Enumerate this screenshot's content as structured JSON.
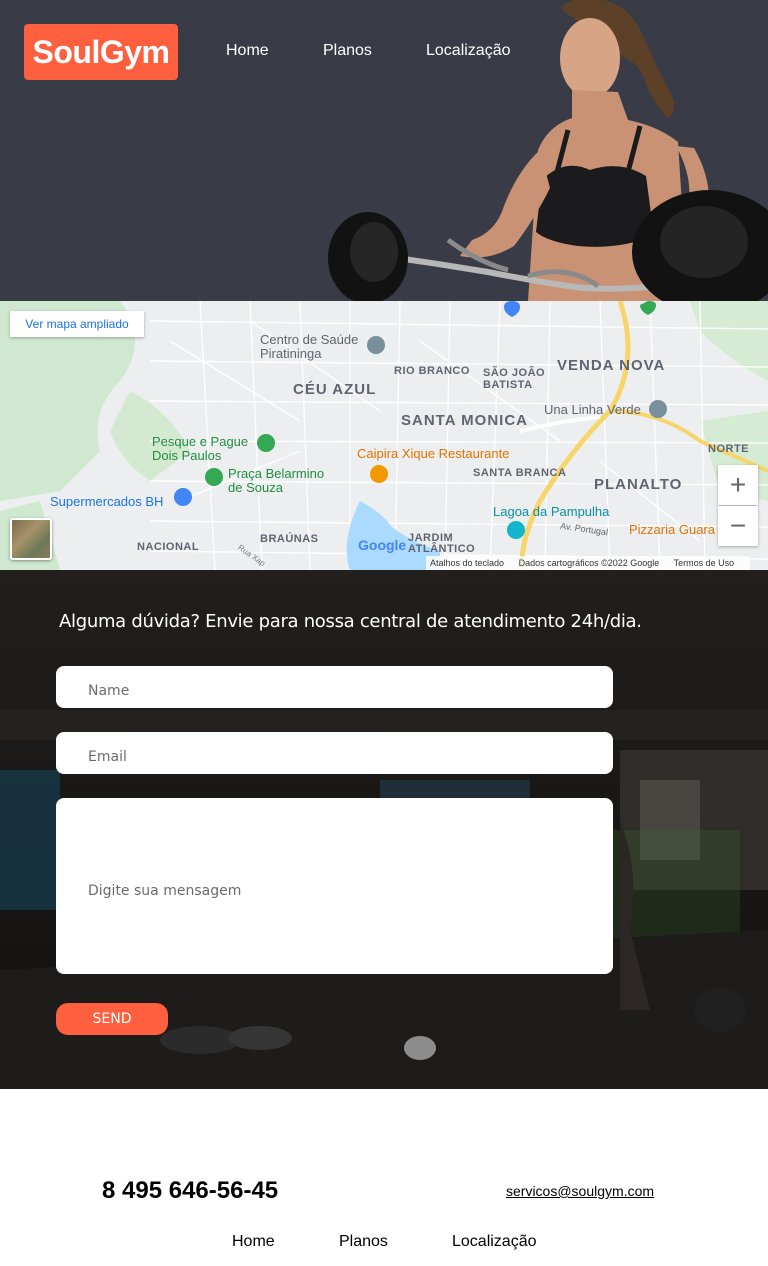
{
  "header": {
    "logo": "SoulGym",
    "nav": [
      "Home",
      "Planos",
      "Localização"
    ]
  },
  "map": {
    "expand_label": "Ver mapa ampliado",
    "zoom_in": "+",
    "zoom_out": "−",
    "google": "Google",
    "footer": [
      "Atalhos do teclado",
      "Dados cartográficos ©2022 Google",
      "Termos de Uso"
    ],
    "labels": {
      "centro_saude": "Centro de Saúde\nPiratininga",
      "ceu_azul": "CÉU AZUL",
      "rio_branco": "RIO BRANCO",
      "sao_joao": "SÃO JOÃO\nBATISTA",
      "venda_nova": "VENDA NOVA",
      "santa_monica": "SANTA MONICA",
      "una_linha": "Una Linha Verde",
      "norte": "NORTE",
      "pesque": "Pesque e Pague\nDois Paulos",
      "caipira": "Caipira Xique Restaurante",
      "praca": "Praça Belarmino\nde Souza",
      "santa_branca": "SANTA BRANCA",
      "planalto": "PLANALTO",
      "supermercados": "Supermercados BH",
      "lagoa": "Lagoa da Pampulha",
      "av_portugal": "Av. Portugal",
      "pizzaria": "Pizzaria Guara",
      "nacional": "NACIONAL",
      "braunas": "BRAÚNAS",
      "jardim": "JARDIM\nATLÂNTICO",
      "rua": "Rua Xap"
    }
  },
  "contact": {
    "title": "Alguma dúvida? Envie para nossa central de atendimento 24h/dia.",
    "name_placeholder": "Name",
    "email_placeholder": "Email",
    "message_placeholder": "Digite sua mensagem",
    "send_label": "SEND"
  },
  "footer": {
    "phone": "8 495 646-56-45",
    "email": "servicos@soulgym.com",
    "nav": [
      "Home",
      "Planos",
      "Localização"
    ]
  },
  "colors": {
    "accent": "#fe5f3f",
    "hero_bg": "#393c46"
  }
}
